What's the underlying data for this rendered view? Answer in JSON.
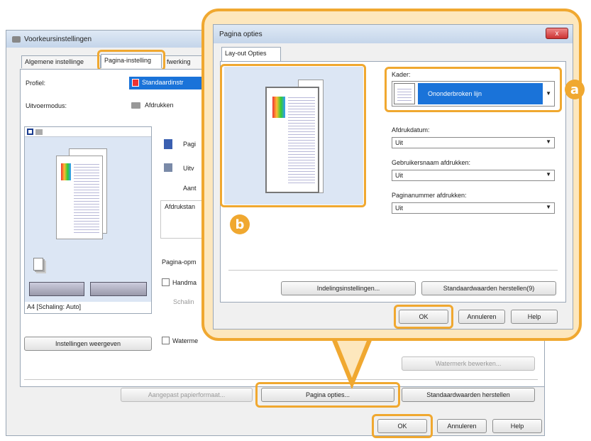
{
  "back_window": {
    "title": "Voorkeursinstellingen",
    "tabs": [
      "Algemene instellinge",
      "Pagina-instelling",
      "fwerking"
    ],
    "profile_label": "Profiel:",
    "profile_value": "Standaardinstr",
    "output_mode_label": "Uitvoermodus:",
    "output_mode_value": "Afdrukken",
    "size_info": "A4 [Schaling: Auto]",
    "show_settings_button": "Instellingen weergeven",
    "right_labels": [
      "Pagi",
      "Uitv",
      "Aant",
      "Afdrukstan"
    ],
    "page_options_label": "Pagina-opm",
    "manual_label": "Handma",
    "scaling_label": "Schalin",
    "watermark_label": "Waterme",
    "watermark_edit_button": "Watermerk bewerken...",
    "custom_paper_button": "Aangepast papierformaat...",
    "page_options_button": "Pagina opties...",
    "restore_defaults_button": "Standaardwaarden herstellen",
    "ok_button": "OK",
    "cancel_button": "Annuleren",
    "help_button": "Help"
  },
  "dialog": {
    "title": "Pagina opties",
    "close_label": "x",
    "tab": "Lay-out Opties",
    "frame_label": "Kader:",
    "frame_value": "Ononderbroken lijn",
    "print_date_label": "Afdrukdatum:",
    "print_date_value": "Uit",
    "print_username_label": "Gebruikersnaam afdrukken:",
    "print_username_value": "Uit",
    "print_pagenum_label": "Paginanummer afdrukken:",
    "print_pagenum_value": "Uit",
    "layout_settings_button": "Indelingsinstellingen...",
    "restore_defaults_button": "Standaardwaarden herstellen(9)",
    "ok_button": "OK",
    "cancel_button": "Annuleren",
    "help_button": "Help"
  },
  "callouts": {
    "a": "a",
    "b": "b"
  },
  "colors": {
    "highlight": "#f0a830",
    "select_blue": "#1a73d9"
  }
}
